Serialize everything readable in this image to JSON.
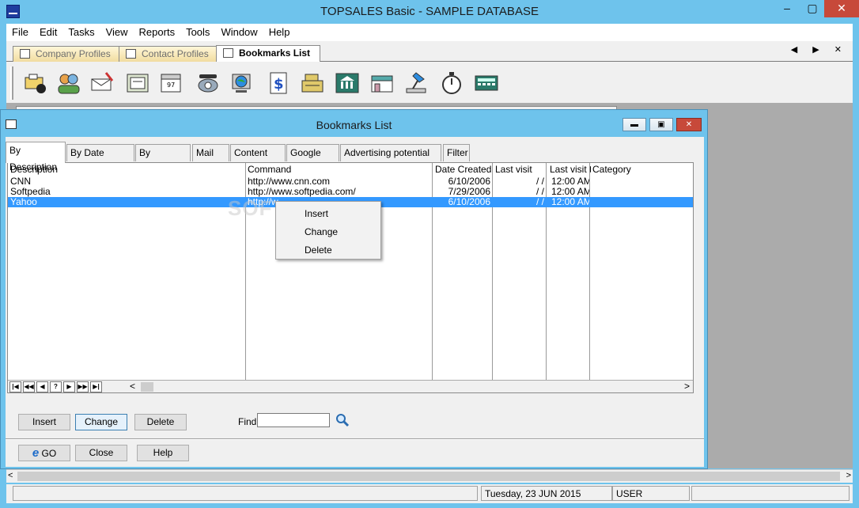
{
  "app": {
    "title": "TOPSALES Basic - SAMPLE DATABASE",
    "window_controls": {
      "minimize": "–",
      "maximize": "▢",
      "close": "✕"
    }
  },
  "menu": [
    "File",
    "Edit",
    "Tasks",
    "View",
    "Reports",
    "Tools",
    "Window",
    "Help"
  ],
  "doc_tabs": [
    {
      "label": "Company Profiles",
      "active": false
    },
    {
      "label": "Contact Profiles",
      "active": false
    },
    {
      "label": "Bookmarks List",
      "active": true
    }
  ],
  "doc_tab_nav": "◀ ▶ ✕",
  "toolbar_icons": [
    "company-profile-icon",
    "contacts-icon",
    "mail-icon",
    "cards-icon",
    "calendar-icon",
    "phone-icon",
    "web-icon",
    "price-icon",
    "cash-register-icon",
    "bank-icon",
    "shop-icon",
    "lamp-icon",
    "stopwatch-icon",
    "calculator-icon"
  ],
  "child_window": {
    "title": "Bookmarks List",
    "controls": {
      "minimize": "▬",
      "maximize": "▣",
      "close": "✕"
    },
    "sub_tabs": [
      {
        "label": "By Description",
        "active": true
      },
      {
        "label": "By Date Created",
        "active": false
      },
      {
        "label": "By Command",
        "active": false
      },
      {
        "label": "Mail List",
        "active": false
      },
      {
        "label": "Content rank",
        "active": false
      },
      {
        "label": "Google rank",
        "active": false
      },
      {
        "label": "Advertising potential rank",
        "active": false
      },
      {
        "label": "Filter",
        "active": false
      }
    ],
    "grid": {
      "columns": [
        "Description",
        "Command",
        "Date Created",
        "Last visit",
        "Last visit ti",
        "Category"
      ],
      "rows": [
        {
          "description": "CNN",
          "command": "http://www.cnn.com",
          "date_created": "6/10/2006",
          "last_visit": "/ /",
          "last_visit_time": "12:00 AM",
          "category": "",
          "selected": false
        },
        {
          "description": "Softpedia",
          "command": "http://www.softpedia.com/",
          "date_created": "7/29/2006",
          "last_visit": "/ /",
          "last_visit_time": "12:00 AM",
          "category": "",
          "selected": false
        },
        {
          "description": "Yahoo",
          "command": "http://w",
          "date_created": "6/10/2006",
          "last_visit": "/ /",
          "last_visit_time": "12:00 AM",
          "category": "",
          "selected": true
        }
      ],
      "nav_buttons": [
        "|◀",
        "◀◀",
        "◀",
        "?",
        "▶",
        "▶▶",
        "▶|"
      ],
      "hscroll": {
        "left": "<",
        "right": ">"
      }
    },
    "context_menu": [
      "Insert",
      "Change",
      "Delete"
    ],
    "buttons": {
      "insert": "Insert",
      "change": "Change",
      "delete": "Delete",
      "go": "GO",
      "close": "Close",
      "help": "Help"
    },
    "find": {
      "label": "Find:",
      "value": ""
    }
  },
  "status": {
    "date": "Tuesday, 23 JUN 2015",
    "user": "USER"
  },
  "watermark": "SOFTPEDIA",
  "colors": {
    "titlebar": "#6ec3ec",
    "selection": "#3399ff",
    "close": "#c7493a"
  }
}
